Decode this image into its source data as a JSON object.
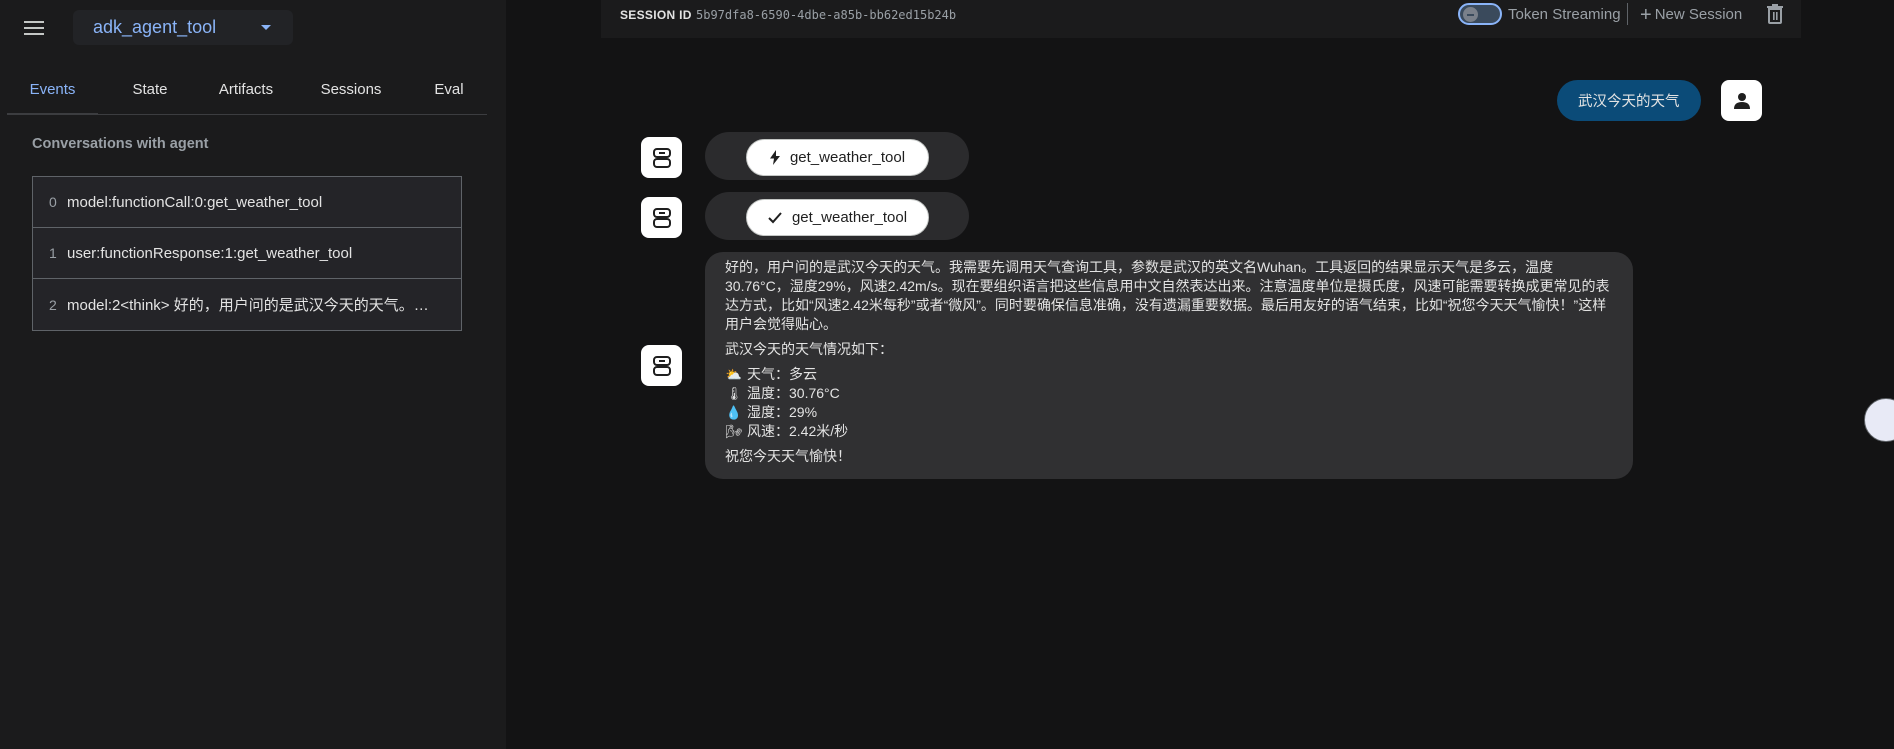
{
  "sidebar": {
    "app_name": "adk_agent_tool",
    "tabs": [
      {
        "label": "Events"
      },
      {
        "label": "State"
      },
      {
        "label": "Artifacts"
      },
      {
        "label": "Sessions"
      },
      {
        "label": "Eval"
      }
    ],
    "section_title": "Conversations with agent",
    "events": [
      {
        "index": "0",
        "text": "model:functionCall:0:get_weather_tool"
      },
      {
        "index": "1",
        "text": "user:functionResponse:1:get_weather_tool"
      },
      {
        "index": "2",
        "text": "model:2<think> 好的，用户问的是武汉今天的天气。我..."
      }
    ]
  },
  "topbar": {
    "session_label": "SESSION ID",
    "session_id": "5b97dfa8-6590-4dbe-a85b-bb62ed15b24b",
    "token_streaming_label": "Token Streaming",
    "new_session_label": "New Session"
  },
  "chat": {
    "user_message": "武汉今天的天气",
    "tool_call": {
      "name": "get_weather_tool",
      "icon": "bolt-icon"
    },
    "tool_response": {
      "name": "get_weather_tool",
      "icon": "check-icon"
    },
    "reply": {
      "think": "好的，用户问的是武汉今天的天气。我需要先调用天气查询工具，参数是武汉的英文名Wuhan。工具返回的结果显示天气是多云，温度30.76°C，湿度29%，风速2.42m/s。现在要组织语言把这些信息用中文自然表达出来。注意温度单位是摄氏度，风速可能需要转换成更常见的表达方式，比如“风速2.42米每秒”或者“微风”。同时要确保信息准确，没有遗漏重要数据。最后用友好的语气结束，比如“祝您今天天气愉快！”这样用户会觉得贴心。",
      "intro": "武汉今天的天气情况如下：",
      "items": [
        {
          "emoji": "⛅",
          "text": "天气：多云"
        },
        {
          "emoji": "🌡",
          "text": "温度：30.76°C"
        },
        {
          "emoji": "💧",
          "text": "湿度：29%"
        },
        {
          "emoji": "🌬",
          "text": "风速：2.42米/秒"
        }
      ],
      "closing": "祝您今天天气愉快！"
    }
  },
  "colors": {
    "accent": "#8ab4f8",
    "user_bubble": "#0b4b78",
    "bot_bubble": "#303032",
    "sidebar_bg": "#1b1b1c",
    "main_bg": "#131314"
  }
}
